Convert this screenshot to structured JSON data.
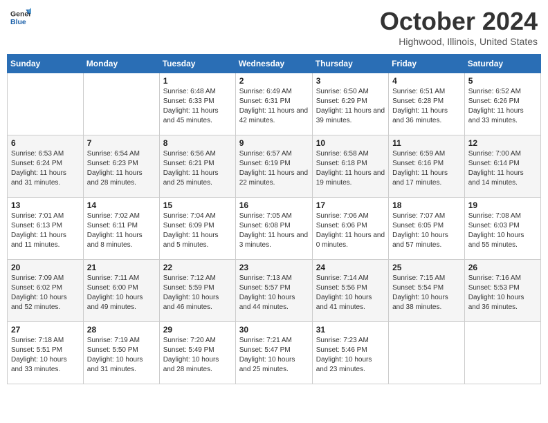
{
  "header": {
    "logo_text_general": "General",
    "logo_text_blue": "Blue",
    "month_title": "October 2024",
    "location": "Highwood, Illinois, United States"
  },
  "weekdays": [
    "Sunday",
    "Monday",
    "Tuesday",
    "Wednesday",
    "Thursday",
    "Friday",
    "Saturday"
  ],
  "weeks": [
    [
      {
        "day": "",
        "sunrise": "",
        "sunset": "",
        "daylight": ""
      },
      {
        "day": "",
        "sunrise": "",
        "sunset": "",
        "daylight": ""
      },
      {
        "day": "1",
        "sunrise": "Sunrise: 6:48 AM",
        "sunset": "Sunset: 6:33 PM",
        "daylight": "Daylight: 11 hours and 45 minutes."
      },
      {
        "day": "2",
        "sunrise": "Sunrise: 6:49 AM",
        "sunset": "Sunset: 6:31 PM",
        "daylight": "Daylight: 11 hours and 42 minutes."
      },
      {
        "day": "3",
        "sunrise": "Sunrise: 6:50 AM",
        "sunset": "Sunset: 6:29 PM",
        "daylight": "Daylight: 11 hours and 39 minutes."
      },
      {
        "day": "4",
        "sunrise": "Sunrise: 6:51 AM",
        "sunset": "Sunset: 6:28 PM",
        "daylight": "Daylight: 11 hours and 36 minutes."
      },
      {
        "day": "5",
        "sunrise": "Sunrise: 6:52 AM",
        "sunset": "Sunset: 6:26 PM",
        "daylight": "Daylight: 11 hours and 33 minutes."
      }
    ],
    [
      {
        "day": "6",
        "sunrise": "Sunrise: 6:53 AM",
        "sunset": "Sunset: 6:24 PM",
        "daylight": "Daylight: 11 hours and 31 minutes."
      },
      {
        "day": "7",
        "sunrise": "Sunrise: 6:54 AM",
        "sunset": "Sunset: 6:23 PM",
        "daylight": "Daylight: 11 hours and 28 minutes."
      },
      {
        "day": "8",
        "sunrise": "Sunrise: 6:56 AM",
        "sunset": "Sunset: 6:21 PM",
        "daylight": "Daylight: 11 hours and 25 minutes."
      },
      {
        "day": "9",
        "sunrise": "Sunrise: 6:57 AM",
        "sunset": "Sunset: 6:19 PM",
        "daylight": "Daylight: 11 hours and 22 minutes."
      },
      {
        "day": "10",
        "sunrise": "Sunrise: 6:58 AM",
        "sunset": "Sunset: 6:18 PM",
        "daylight": "Daylight: 11 hours and 19 minutes."
      },
      {
        "day": "11",
        "sunrise": "Sunrise: 6:59 AM",
        "sunset": "Sunset: 6:16 PM",
        "daylight": "Daylight: 11 hours and 17 minutes."
      },
      {
        "day": "12",
        "sunrise": "Sunrise: 7:00 AM",
        "sunset": "Sunset: 6:14 PM",
        "daylight": "Daylight: 11 hours and 14 minutes."
      }
    ],
    [
      {
        "day": "13",
        "sunrise": "Sunrise: 7:01 AM",
        "sunset": "Sunset: 6:13 PM",
        "daylight": "Daylight: 11 hours and 11 minutes."
      },
      {
        "day": "14",
        "sunrise": "Sunrise: 7:02 AM",
        "sunset": "Sunset: 6:11 PM",
        "daylight": "Daylight: 11 hours and 8 minutes."
      },
      {
        "day": "15",
        "sunrise": "Sunrise: 7:04 AM",
        "sunset": "Sunset: 6:09 PM",
        "daylight": "Daylight: 11 hours and 5 minutes."
      },
      {
        "day": "16",
        "sunrise": "Sunrise: 7:05 AM",
        "sunset": "Sunset: 6:08 PM",
        "daylight": "Daylight: 11 hours and 3 minutes."
      },
      {
        "day": "17",
        "sunrise": "Sunrise: 7:06 AM",
        "sunset": "Sunset: 6:06 PM",
        "daylight": "Daylight: 11 hours and 0 minutes."
      },
      {
        "day": "18",
        "sunrise": "Sunrise: 7:07 AM",
        "sunset": "Sunset: 6:05 PM",
        "daylight": "Daylight: 10 hours and 57 minutes."
      },
      {
        "day": "19",
        "sunrise": "Sunrise: 7:08 AM",
        "sunset": "Sunset: 6:03 PM",
        "daylight": "Daylight: 10 hours and 55 minutes."
      }
    ],
    [
      {
        "day": "20",
        "sunrise": "Sunrise: 7:09 AM",
        "sunset": "Sunset: 6:02 PM",
        "daylight": "Daylight: 10 hours and 52 minutes."
      },
      {
        "day": "21",
        "sunrise": "Sunrise: 7:11 AM",
        "sunset": "Sunset: 6:00 PM",
        "daylight": "Daylight: 10 hours and 49 minutes."
      },
      {
        "day": "22",
        "sunrise": "Sunrise: 7:12 AM",
        "sunset": "Sunset: 5:59 PM",
        "daylight": "Daylight: 10 hours and 46 minutes."
      },
      {
        "day": "23",
        "sunrise": "Sunrise: 7:13 AM",
        "sunset": "Sunset: 5:57 PM",
        "daylight": "Daylight: 10 hours and 44 minutes."
      },
      {
        "day": "24",
        "sunrise": "Sunrise: 7:14 AM",
        "sunset": "Sunset: 5:56 PM",
        "daylight": "Daylight: 10 hours and 41 minutes."
      },
      {
        "day": "25",
        "sunrise": "Sunrise: 7:15 AM",
        "sunset": "Sunset: 5:54 PM",
        "daylight": "Daylight: 10 hours and 38 minutes."
      },
      {
        "day": "26",
        "sunrise": "Sunrise: 7:16 AM",
        "sunset": "Sunset: 5:53 PM",
        "daylight": "Daylight: 10 hours and 36 minutes."
      }
    ],
    [
      {
        "day": "27",
        "sunrise": "Sunrise: 7:18 AM",
        "sunset": "Sunset: 5:51 PM",
        "daylight": "Daylight: 10 hours and 33 minutes."
      },
      {
        "day": "28",
        "sunrise": "Sunrise: 7:19 AM",
        "sunset": "Sunset: 5:50 PM",
        "daylight": "Daylight: 10 hours and 31 minutes."
      },
      {
        "day": "29",
        "sunrise": "Sunrise: 7:20 AM",
        "sunset": "Sunset: 5:49 PM",
        "daylight": "Daylight: 10 hours and 28 minutes."
      },
      {
        "day": "30",
        "sunrise": "Sunrise: 7:21 AM",
        "sunset": "Sunset: 5:47 PM",
        "daylight": "Daylight: 10 hours and 25 minutes."
      },
      {
        "day": "31",
        "sunrise": "Sunrise: 7:23 AM",
        "sunset": "Sunset: 5:46 PM",
        "daylight": "Daylight: 10 hours and 23 minutes."
      },
      {
        "day": "",
        "sunrise": "",
        "sunset": "",
        "daylight": ""
      },
      {
        "day": "",
        "sunrise": "",
        "sunset": "",
        "daylight": ""
      }
    ]
  ]
}
